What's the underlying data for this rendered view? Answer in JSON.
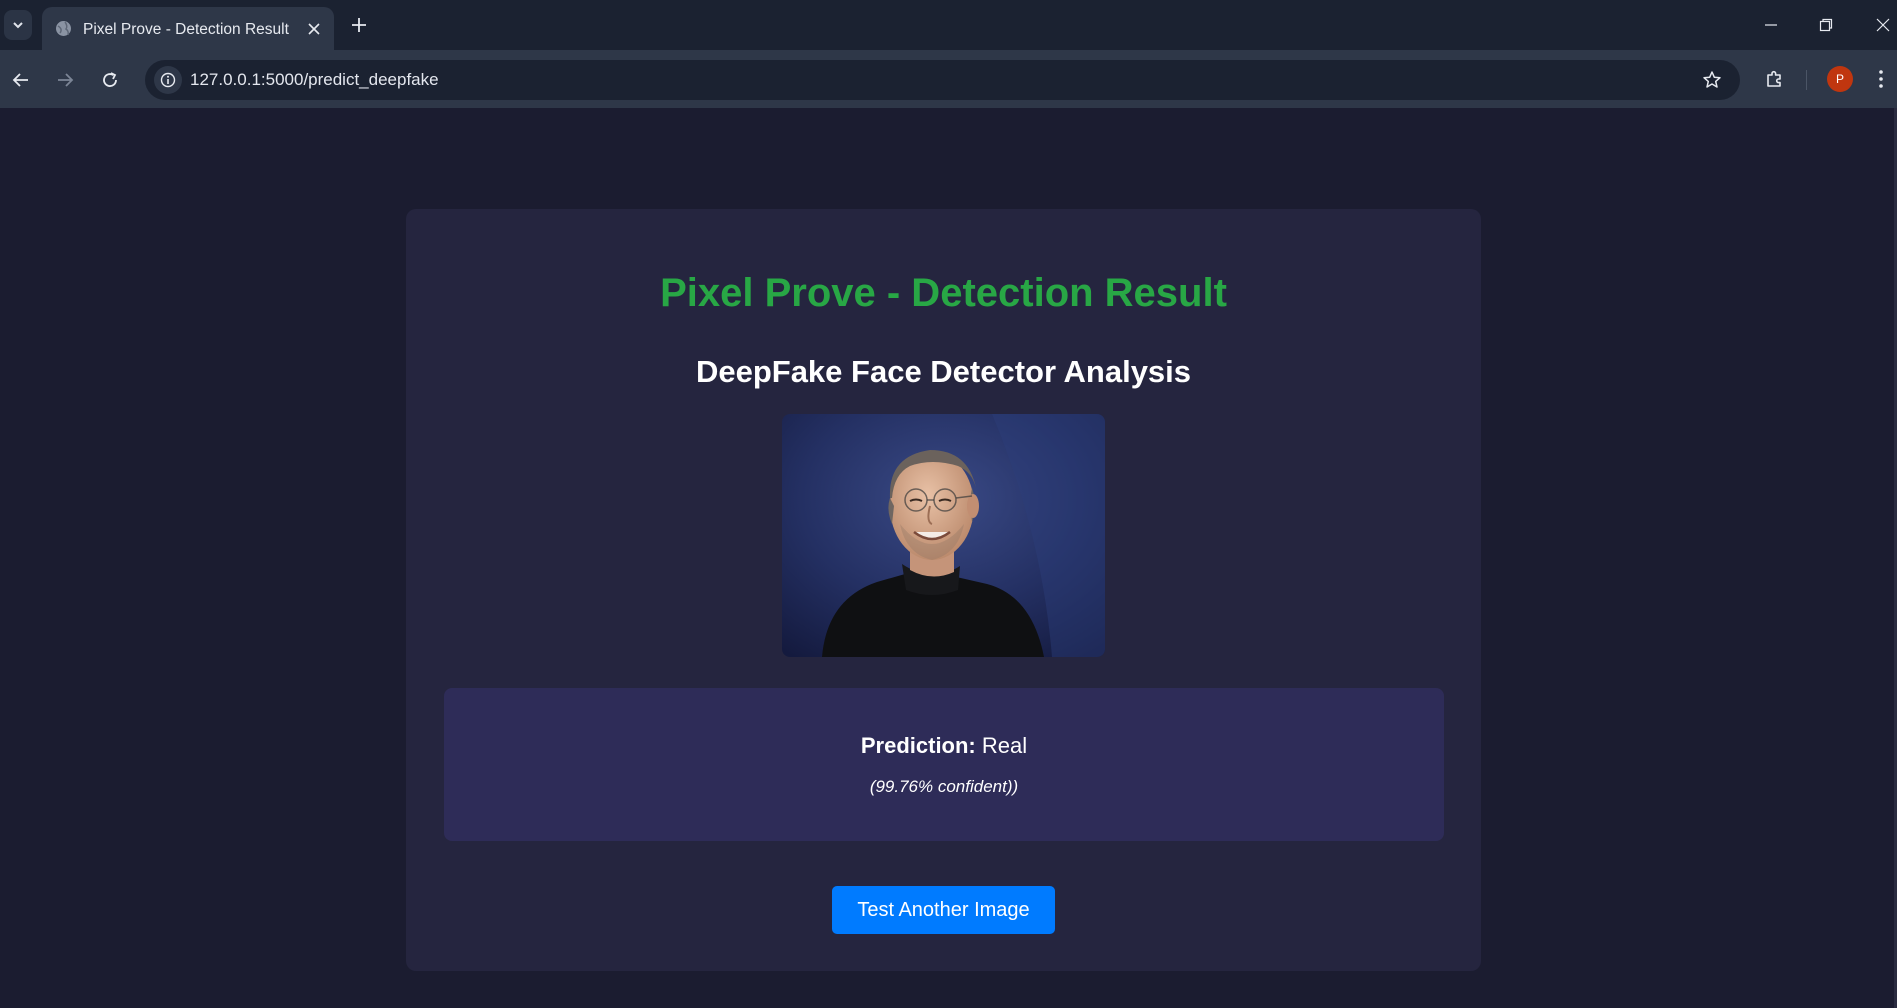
{
  "browser": {
    "tab_title": "Pixel Prove - Detection Result",
    "url": "127.0.0.1:5000/predict_deepfake",
    "profile_initial": "P"
  },
  "page": {
    "title": "Pixel Prove - Detection Result",
    "subtitle": "DeepFake Face Detector Analysis",
    "prediction_label": "Prediction:",
    "prediction_value": "Real",
    "confidence_text": "(99.76% confident))",
    "button_label": "Test Another Image"
  },
  "colors": {
    "title_green": "#28a745",
    "button_blue": "#007bff",
    "card_bg": "#25253f",
    "result_bg": "#2e2c58",
    "page_bg": "#1b1c30"
  }
}
